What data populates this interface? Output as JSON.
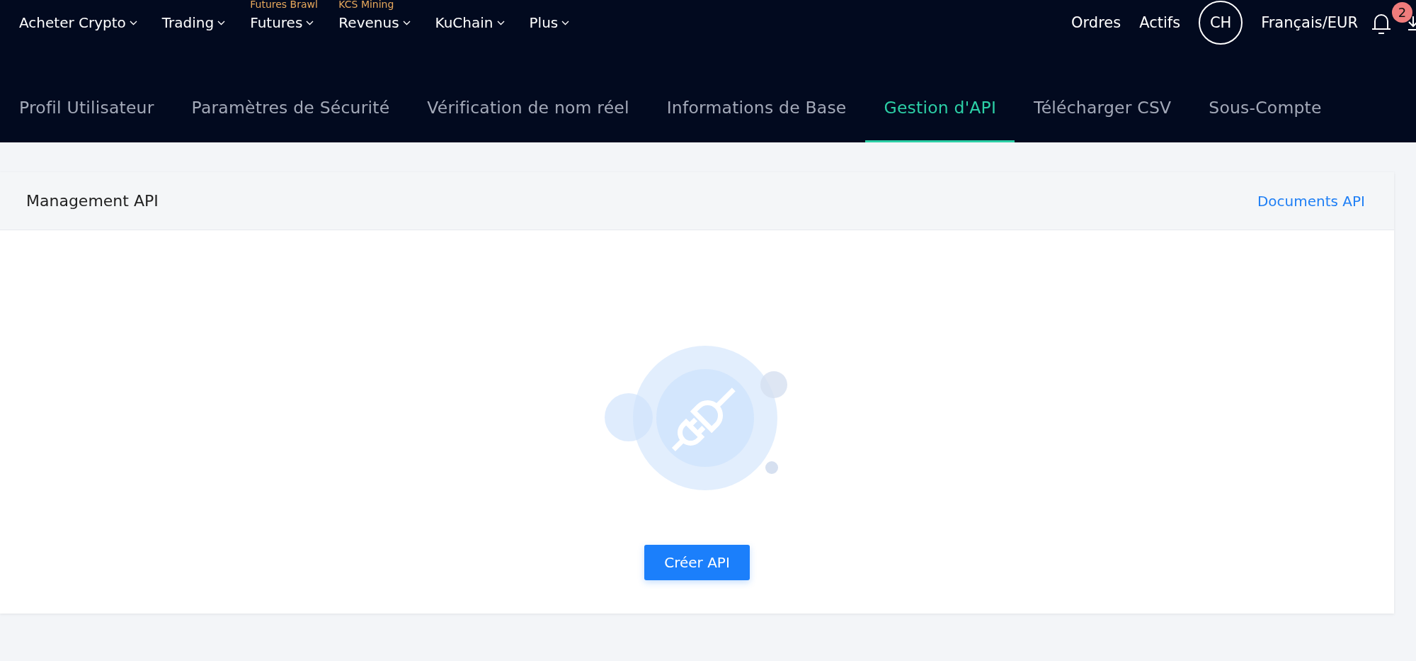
{
  "top_nav": {
    "items": [
      {
        "label": "Acheter Crypto"
      },
      {
        "label": "Trading"
      },
      {
        "label": "Futures",
        "tag": "Futures Brawl"
      },
      {
        "label": "Revenus",
        "tag": "KCS Mining"
      },
      {
        "label": "KuChain"
      },
      {
        "label": "Plus"
      }
    ],
    "right_links": [
      "Ordres",
      "Actifs"
    ],
    "avatar": "CH",
    "language": "Français/EUR",
    "notification_count": "2"
  },
  "tabs": [
    {
      "label": "Profil Utilisateur",
      "selected": false
    },
    {
      "label": "Paramètres de Sécurité",
      "selected": false
    },
    {
      "label": "Vérification de nom réel",
      "selected": false
    },
    {
      "label": "Informations de Base",
      "selected": false
    },
    {
      "label": "Gestion d'API",
      "selected": true
    },
    {
      "label": "Télécharger CSV",
      "selected": false
    },
    {
      "label": "Sous-Compte",
      "selected": false
    }
  ],
  "panel": {
    "title": "Management API",
    "docs_link": "Documents API",
    "button": "Créer API"
  }
}
